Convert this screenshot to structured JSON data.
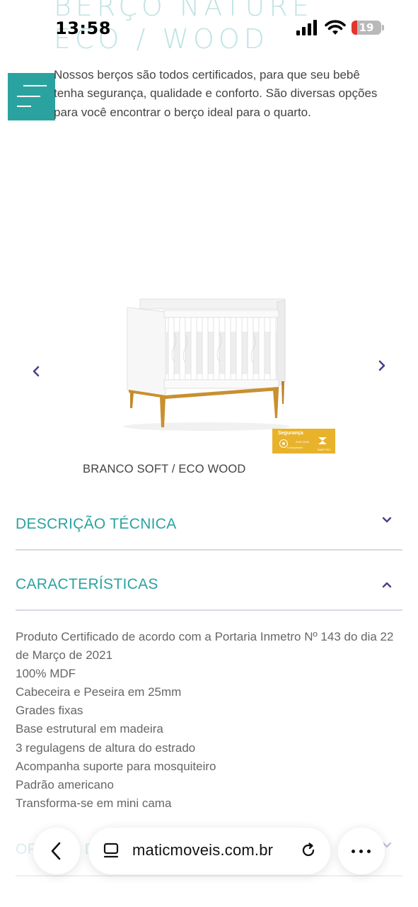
{
  "status_bar": {
    "time": "13:58",
    "battery_level": "19",
    "battery_fraction": 0.19
  },
  "page": {
    "title": "BERÇO NATURE ECO / WOOD",
    "intro": "Nossos berços são todos certificados, para que seu bebê tenha segurança, qualidade e conforto. São diversas opções para você encontrar o berço ideal para o quarto.",
    "menu_icon": "hamburger-menu-icon"
  },
  "gallery": {
    "prev_icon": "chevron-left-icon",
    "next_icon": "chevron-right-icon",
    "variant_name": "BRANCO SOFT / ECO WOOD",
    "badge": {
      "title": "Segurança",
      "code": "3402-3025",
      "subtitle": "Compulsório",
      "org": "INMETRO"
    }
  },
  "accordion": [
    {
      "label": "DESCRIÇÃO TÉCNICA",
      "icon": "chevron-down-icon",
      "expanded": false
    },
    {
      "label": "CARACTERÍSTICAS",
      "icon": "chevron-up-icon",
      "expanded": true
    },
    {
      "label": "OPÇÕES DE COR",
      "icon": "chevron-down-icon",
      "expanded": false
    }
  ],
  "features": [
    "Produto Certificado de acordo com a Portaria Inmetro Nº 143 do dia 22 de Março de 2021",
    "100% MDF",
    "Cabeceira e Peseira em 25mm",
    "Grades fixas",
    "Base estrutural em madeira",
    "3 regulagens de altura do estrado",
    "Acompanha suporte para mosquiteiro",
    "Padrão americano",
    "Transforma-se em mini cama"
  ],
  "browser_bar": {
    "url": "maticmoveis.com.br",
    "back_icon": "back-arrow-icon",
    "tabs_icon": "tabs-icon",
    "reload_icon": "reload-icon",
    "more_icon": "more-dots-icon"
  },
  "colors": {
    "accent": "#2aa3a0",
    "title_faded": "#bfe3e3",
    "chevron": "#4b3f8f",
    "badge": "#e8b22a",
    "wood": "#c8902f"
  }
}
